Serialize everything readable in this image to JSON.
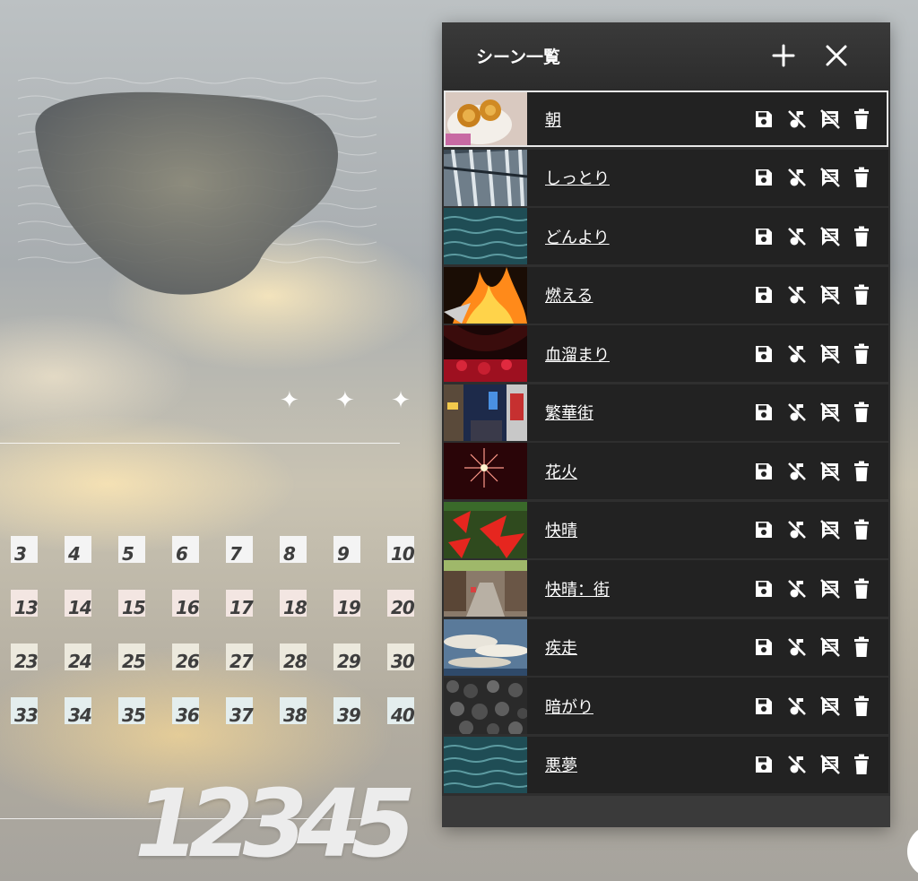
{
  "background": {
    "sparkles": "✦ ✦ ✦",
    "calendar_rows": [
      [
        "3",
        "4",
        "5",
        "6",
        "7",
        "8",
        "9",
        "10"
      ],
      [
        "13",
        "14",
        "15",
        "16",
        "17",
        "18",
        "19",
        "20"
      ],
      [
        "23",
        "24",
        "25",
        "26",
        "27",
        "28",
        "29",
        "30"
      ],
      [
        "33",
        "34",
        "35",
        "36",
        "37",
        "38",
        "39",
        "40"
      ]
    ],
    "big_number": "12345"
  },
  "panel": {
    "title": "シーン一覧",
    "add_icon": "plus-icon",
    "close_icon": "close-icon",
    "row_action_icons": [
      "save-icon",
      "music-off-icon",
      "comment-off-icon",
      "trash-icon"
    ],
    "selected_index": 0,
    "scenes": [
      {
        "name": "朝",
        "thumb": "morning-pastries"
      },
      {
        "name": "しっとり",
        "thumb": "waterfall"
      },
      {
        "name": "どんより",
        "thumb": "sea-water"
      },
      {
        "name": "燃える",
        "thumb": "fire"
      },
      {
        "name": "血溜まり",
        "thumb": "red-flowers-field"
      },
      {
        "name": "繁華街",
        "thumb": "city-street-night"
      },
      {
        "name": "花火",
        "thumb": "fireworks"
      },
      {
        "name": "快晴",
        "thumb": "red-flowers"
      },
      {
        "name": "快晴：街",
        "thumb": "town-street"
      },
      {
        "name": "疾走",
        "thumb": "clouds-sky"
      },
      {
        "name": "暗がり",
        "thumb": "dark-stones"
      },
      {
        "name": "悪夢",
        "thumb": "sea-water"
      }
    ]
  },
  "colors": {
    "panel_bg": "#2f2f2f",
    "row_bg": "#222222",
    "text": "#ffffff"
  }
}
